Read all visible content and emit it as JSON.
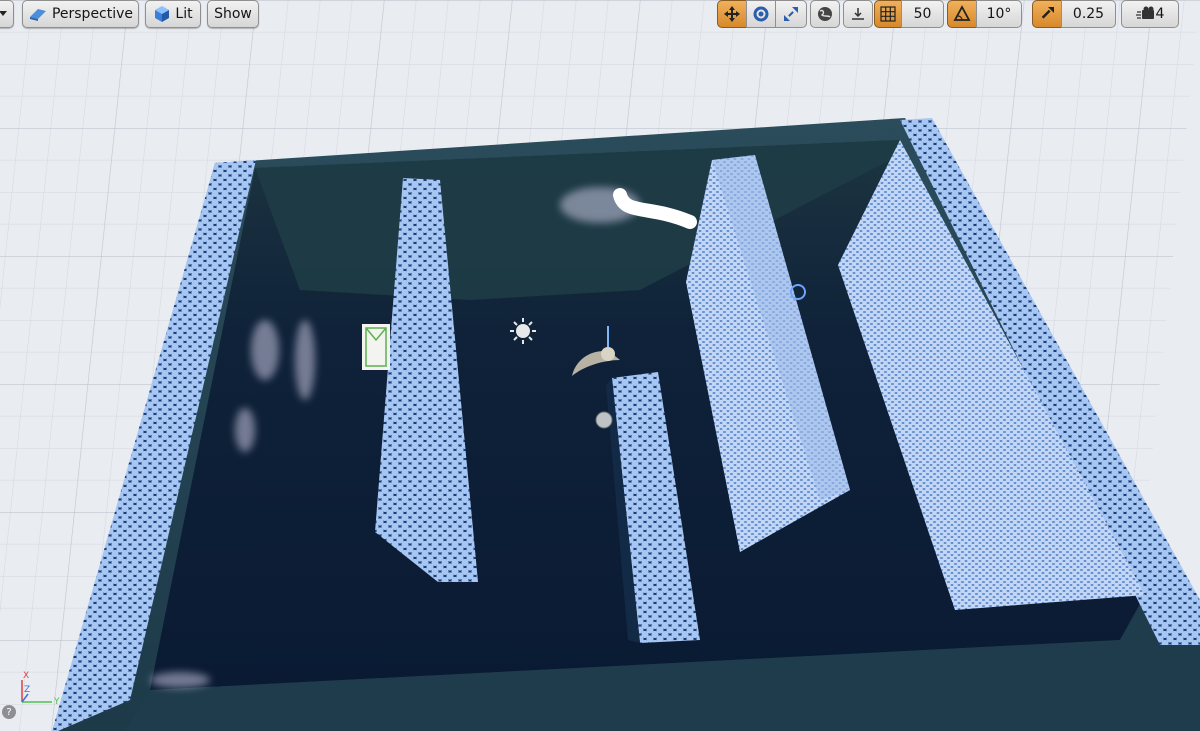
{
  "toolbar": {
    "viewport_mode": "Perspective",
    "view_mode": "Lit",
    "show_label": "Show",
    "grid_snap_value": "50",
    "rotation_snap_value": "10°",
    "scale_snap_value": "0.25",
    "camera_speed_value": "4"
  },
  "axis": {
    "x_label": "X",
    "y_label": "Y",
    "z_label": "Z"
  },
  "icons": {
    "perspective": "perspective-icon",
    "lit": "lit-cube-icon",
    "translate": "translate-icon",
    "rotate": "rotate-icon",
    "scale": "scale-icon",
    "world": "world-space-icon",
    "surface_snap": "surface-snap-icon",
    "grid_snap": "grid-snap-icon",
    "rotation_snap": "rotation-snap-icon",
    "scale_snap": "scale-snap-icon",
    "camera_speed": "camera-speed-icon",
    "directional_light": "sun-icon",
    "player_start": "player-start-icon",
    "reflection_sphere": "sphere-icon"
  },
  "colors": {
    "active_toggle": "#e0982f",
    "hex_wall": "#7fa6e3",
    "water": "#0f2038",
    "grid": "#e9ecf1"
  }
}
